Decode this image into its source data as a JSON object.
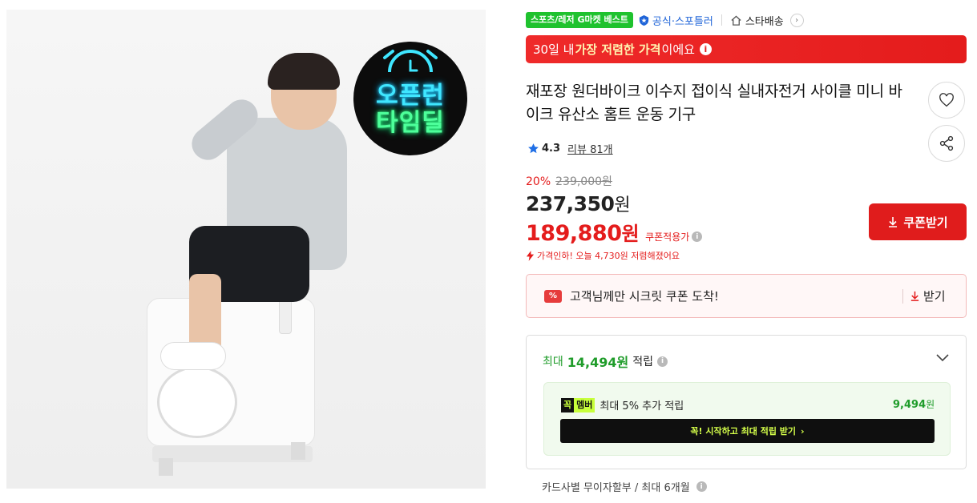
{
  "image": {
    "overlay_line1": "오픈런",
    "overlay_line2": "타임딜"
  },
  "badges": {
    "best": "스포츠/레저 G마켓 베스트",
    "official": "공식·스포틀러",
    "star_delivery": "스타배송"
  },
  "banner": {
    "prefix": "30일 내 ",
    "emphasis": "가장 저렴한 가격",
    "suffix": "이에요"
  },
  "product": {
    "title": "재포장 원더바이크 이수지 접이식 실내자전거 사이클 미니 바이크 유산소 홈트 운동 기구"
  },
  "rating": {
    "score": "4.3",
    "review_label": "리뷰 81개"
  },
  "price": {
    "discount_rate": "20%",
    "original": "239,000원",
    "sale_value": "237,350",
    "sale_unit": "원",
    "coupon_value": "189,880",
    "coupon_unit": "원",
    "coupon_label": "쿠폰적용가",
    "drop_text": "가격인하! 오늘 4,730원 저렴해졌어요"
  },
  "coupon_button": {
    "label": "쿠폰받기"
  },
  "secret_coupon": {
    "icon": "%",
    "text": "고객님께만 시크릿 쿠폰 도착!",
    "action": "받기"
  },
  "reward": {
    "prefix": "최대",
    "amount": "14,494원",
    "label": "적립",
    "member_logo_a": "꼭",
    "member_logo_b": "멤버",
    "member_desc": "최대 5% 추가 적립",
    "member_points": "9,494",
    "member_points_unit": "원",
    "member_cta": "꼭! 시작하고 최대 적립 받기"
  },
  "installment": {
    "text": "카드사별 무이자할부 / 최대 6개월"
  },
  "colors": {
    "accent_red": "#e41c1c",
    "green": "#1fc22e",
    "official_blue": "#1f64d8",
    "reward_green": "#1f9c2a"
  },
  "icons": [
    "clock-icon",
    "official-shield-icon",
    "house-icon",
    "chevron-right-icon",
    "info-icon",
    "heart-icon",
    "share-icon",
    "star-icon",
    "download-icon",
    "lightning-icon",
    "chevron-down-icon"
  ]
}
